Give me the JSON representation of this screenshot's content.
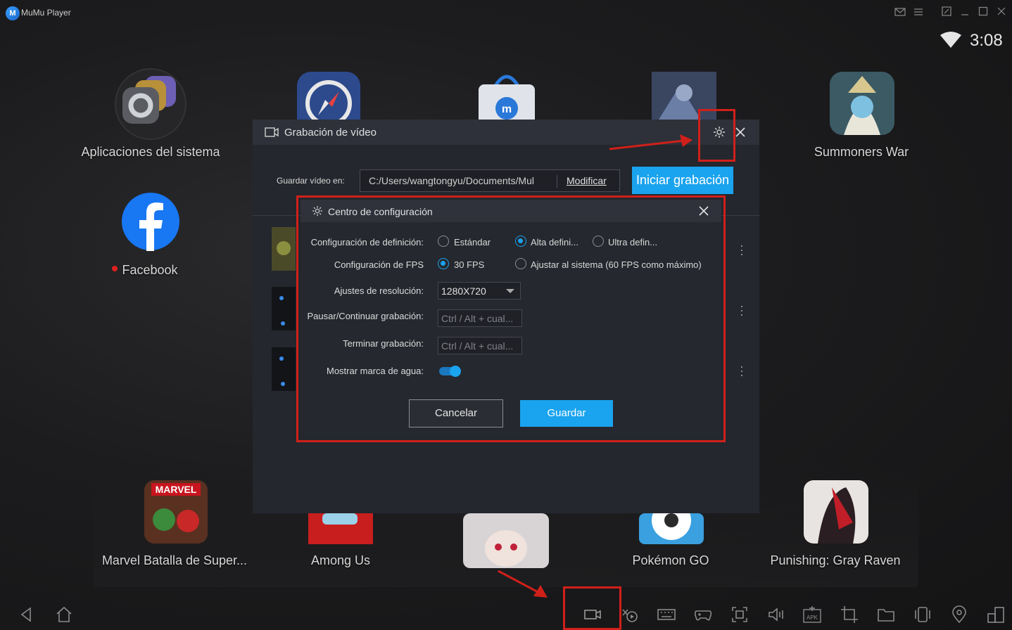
{
  "app": {
    "name": "MuMu Player",
    "logo_letter": "M",
    "clock": "3:08"
  },
  "desktop_apps": [
    {
      "label": "Aplicaciones del sistema",
      "icon": "gear-folder-icon"
    },
    {
      "label": "Facebook",
      "icon": "facebook-icon",
      "new_badge": true
    },
    {
      "label": "Summoners War",
      "icon": "game-icon"
    }
  ],
  "dock_apps": [
    {
      "label": "Marvel Batalla de Super..."
    },
    {
      "label": "Among Us"
    },
    {
      "label": "Pokémon GO"
    },
    {
      "label": "Punishing: Gray Raven"
    }
  ],
  "video_dialog": {
    "title": "Grabación de vídeo",
    "save_label": "Guardar vídeo en:",
    "save_path": "C:/Users/wangtongyu/Documents/Mul",
    "modify_label": "Modificar",
    "start_label": "Iniciar grabación"
  },
  "config_dialog": {
    "title": "Centro de configuración",
    "definition": {
      "label": "Configuración de definición:",
      "options": [
        "Estándar",
        "Alta defini...",
        "Ultra defin..."
      ],
      "selected": "Alta defini..."
    },
    "fps": {
      "label": "Configuración de FPS",
      "options": [
        "30 FPS",
        "Ajustar al sistema (60 FPS como máximo)"
      ],
      "selected": "30 FPS"
    },
    "resolution": {
      "label": "Ajustes de resolución:",
      "value": "1280X720"
    },
    "pause_hotkey": {
      "label": "Pausar/Continuar grabación:",
      "placeholder": "Ctrl / Alt + cual..."
    },
    "stop_hotkey": {
      "label": "Terminar grabación:",
      "placeholder": "Ctrl / Alt + cual..."
    },
    "watermark": {
      "label": "Mostrar marca de agua:",
      "enabled": true
    },
    "cancel_label": "Cancelar",
    "save_label": "Guardar"
  },
  "colors": {
    "accent": "#1aa3ee",
    "highlight": "#d0201a",
    "dialog_bg": "#24272d"
  }
}
